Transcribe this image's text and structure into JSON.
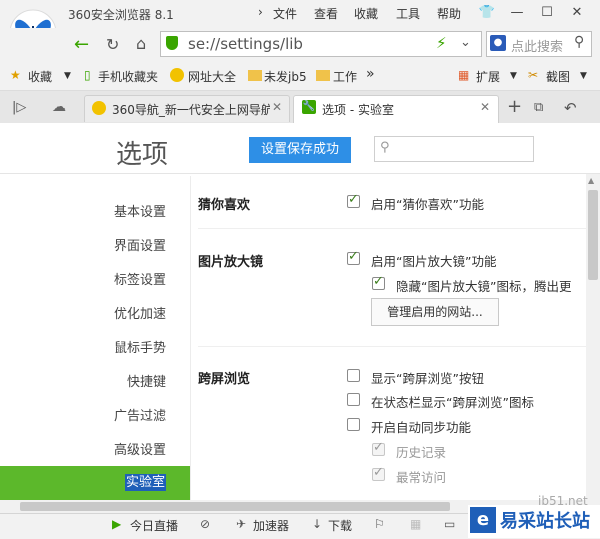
{
  "window": {
    "title": "360安全浏览器 8.1",
    "menu": [
      "文件",
      "查看",
      "收藏",
      "工具",
      "帮助"
    ]
  },
  "address": {
    "url": "se://settings/lib",
    "search_placeholder": "点此搜索"
  },
  "bookmarks": {
    "favorites": "收藏",
    "items": [
      "手机收藏夹",
      "网址大全",
      "未发jb5",
      "工作"
    ],
    "more": "»",
    "extensions": "扩展",
    "screenshot": "截图"
  },
  "tabs": [
    {
      "label": "360导航_新一代安全上网导航"
    },
    {
      "label": "选项 - 实验室"
    }
  ],
  "page": {
    "title": "选项",
    "saved_button": "设置保存成功",
    "search_placeholder": ""
  },
  "sidebar": {
    "items": [
      "基本设置",
      "界面设置",
      "标签设置",
      "优化加速",
      "鼠标手势",
      "快捷键",
      "广告过滤",
      "高级设置",
      "实验室"
    ],
    "active": "实验室"
  },
  "sections": {
    "guess": {
      "title": "猜你喜欢",
      "options": [
        {
          "label": "启用“猜你喜欢”功能",
          "checked": true
        }
      ]
    },
    "magnifier": {
      "title": "图片放大镜",
      "options": [
        {
          "label": "启用“图片放大镜”功能",
          "checked": true
        },
        {
          "label": "隐藏“图片放大镜”图标，腾出更",
          "checked": true
        }
      ],
      "manage_button": "管理启用的网站..."
    },
    "crossscreen": {
      "title": "跨屏浏览",
      "options": [
        {
          "label": "显示“跨屏浏览”按钮",
          "checked": false
        },
        {
          "label": "在状态栏显示“跨屏浏览”图标",
          "checked": false
        },
        {
          "label": "开启自动同步功能",
          "checked": false
        },
        {
          "label": "历史记录",
          "checked": true,
          "disabled": true
        },
        {
          "label": "最常访问",
          "checked": true,
          "disabled": true
        }
      ]
    }
  },
  "statusbar": {
    "live": "今日直播",
    "accelerator": "加速器",
    "download": "下载"
  },
  "watermark": {
    "text": "易采站长站",
    "url": "jb51.net"
  },
  "colors": {
    "accent_green": "#5cb82b",
    "button_blue": "#2e8fe6",
    "nav_green": "#3aa500"
  }
}
